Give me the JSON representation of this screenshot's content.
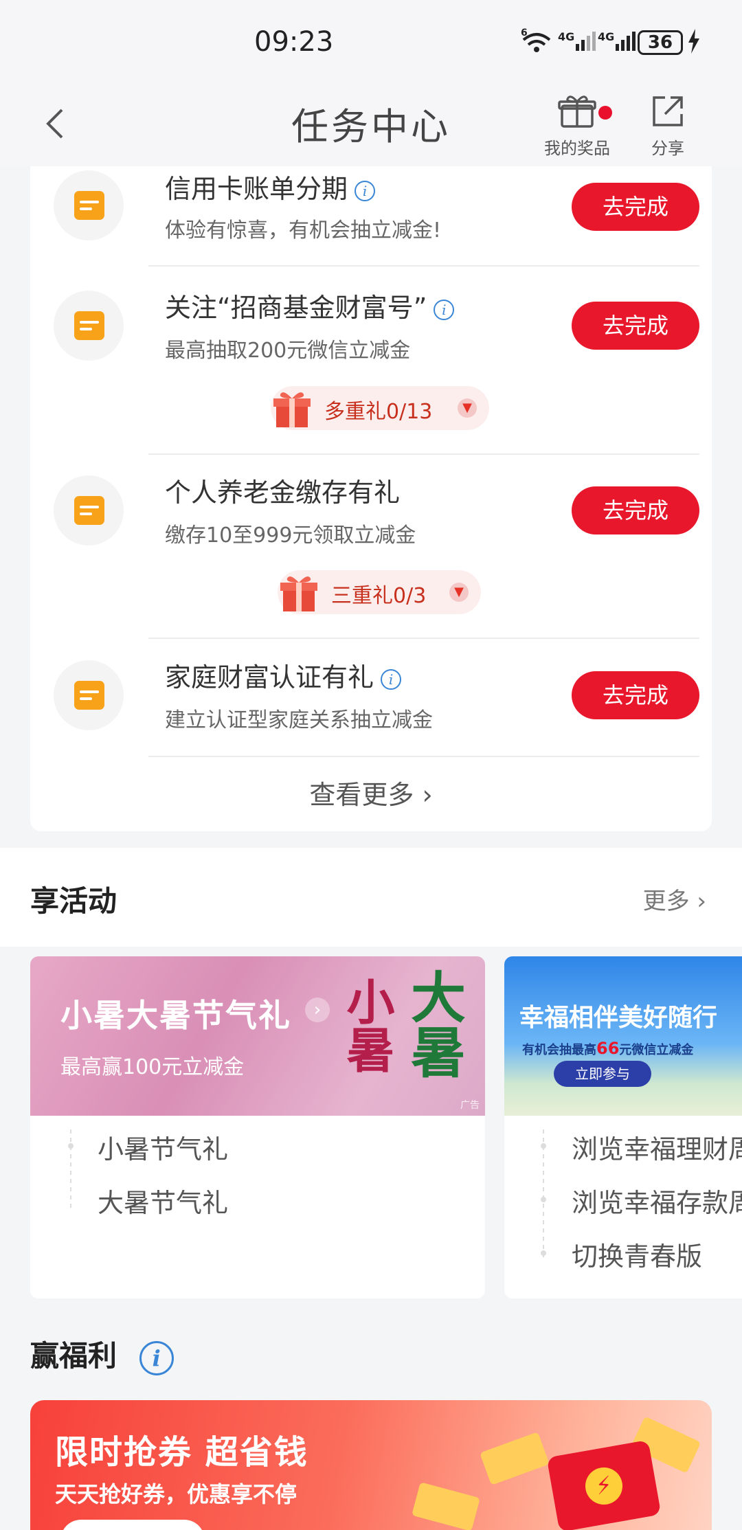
{
  "status": {
    "time": "09:23",
    "battery": "36",
    "net1": "6",
    "net2": "4G",
    "net3": "4G"
  },
  "nav": {
    "title": "任务中心",
    "prizes_label": "我的奖品",
    "share_label": "分享"
  },
  "tasks": [
    {
      "title": "信用卡账单分期",
      "subtitle": "体验有惊喜，有机会抽立减金!",
      "button": "去完成",
      "has_info": true
    },
    {
      "title": "关注“招商基金财富号”",
      "subtitle": "最高抽取200元微信立减金",
      "button": "去完成",
      "has_info": true,
      "gift": "多重礼0/13"
    },
    {
      "title": "个人养老金缴存有礼",
      "subtitle": "缴存10至999元领取立减金",
      "button": "去完成",
      "has_info": false,
      "gift": "三重礼0/3"
    },
    {
      "title": "家庭财富认证有礼",
      "subtitle": "建立认证型家庭关系抽立减金",
      "button": "去完成",
      "has_info": true
    }
  ],
  "view_more": "查看更多",
  "activities": {
    "heading": "享活动",
    "more": "更多",
    "cards": [
      {
        "banner_title": "小暑大暑节气礼",
        "banner_subtitle": "最高赢100元立减金",
        "art_a": "小暑",
        "art_b": "大暑",
        "ad_tag": "广告",
        "items": [
          "小暑节气礼",
          "大暑节气礼"
        ]
      },
      {
        "banner_title": "幸福相伴美好随行",
        "banner_subtitle_pre": "有机会抽最高",
        "banner_subtitle_num": "66",
        "banner_subtitle_post": "元微信立减金",
        "banner_button": "立即参与",
        "items": [
          "浏览幸福理财周",
          "浏览幸福存款周",
          "切换青春版"
        ]
      }
    ]
  },
  "welfare": {
    "heading": "赢福利",
    "promo_title": "限时抢券 超省钱",
    "promo_subtitle": "天天抢好券，优惠享不停"
  },
  "colors": {
    "accent": "#e8172b",
    "task_icon": "#f8a21a",
    "info": "#3a86d6"
  }
}
